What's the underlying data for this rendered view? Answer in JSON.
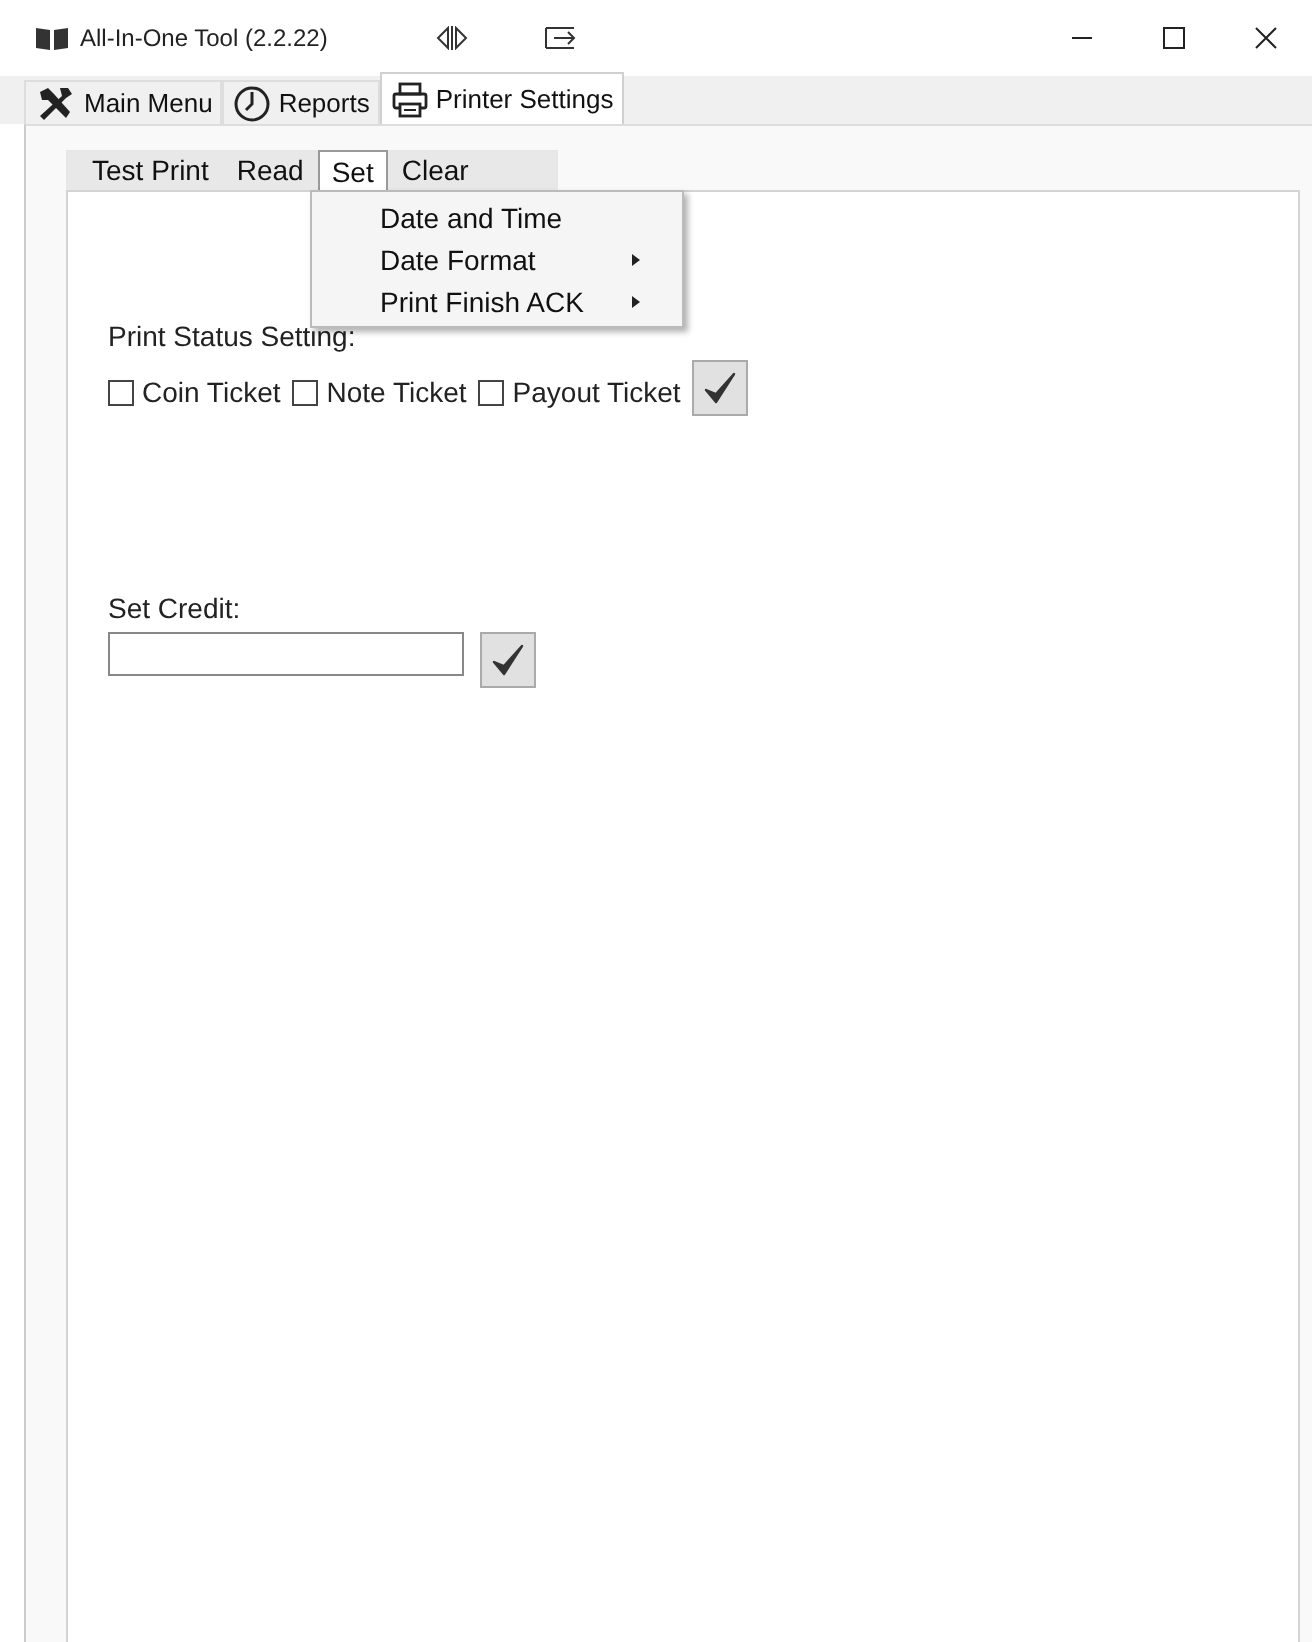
{
  "window": {
    "title": "All-In-One Tool (2.2.22)"
  },
  "tabs": [
    {
      "label": "Main Menu",
      "selected": false
    },
    {
      "label": "Reports",
      "selected": false
    },
    {
      "label": "Printer Settings",
      "selected": true
    }
  ],
  "menu_bar": [
    {
      "label": "Test Print",
      "selected": false
    },
    {
      "label": "Read",
      "selected": false
    },
    {
      "label": "Set",
      "selected": true
    },
    {
      "label": "Clear",
      "selected": false
    }
  ],
  "dropdown": [
    {
      "label": "Date and Time",
      "has_submenu": false
    },
    {
      "label": "Date Format",
      "has_submenu": true
    },
    {
      "label": "Print Finish ACK",
      "has_submenu": true
    }
  ],
  "print_status": {
    "label": "Print Status Setting:",
    "options": [
      {
        "label": "Coin Ticket",
        "checked": false
      },
      {
        "label": "Note Ticket",
        "checked": false
      },
      {
        "label": "Payout Ticket",
        "checked": false
      }
    ]
  },
  "set_credit": {
    "label": "Set Credit:"
  }
}
